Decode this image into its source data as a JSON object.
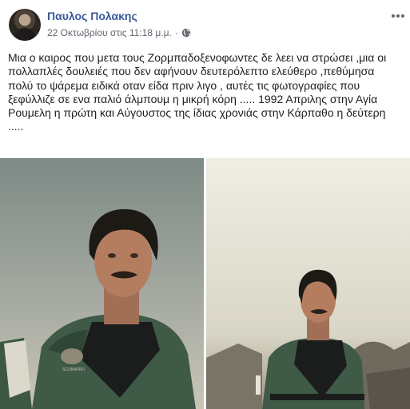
{
  "post": {
    "author": "Παυλος Πολακης",
    "timestamp": "22 Οκτωβρίου στις 11:18 μ.μ.",
    "separator": "·",
    "privacy_icon": "globe-icon",
    "more_icon": "more-options-icon",
    "text_lines": [
      "Μια ο καιρος που μετα τους Ζορμπαδοξενοφωντες δε λεει να στρώσει ,μια οι",
      "πολλαπλές δουλειές που δεν αφήνουν δευτερόλεπτο ελεύθερο ,πεθύμησα",
      "πολύ το ψάρεμα ειδικά οταν είδα πριν λιγο , αυτές τις φωτογραφίες που",
      "ξεφύλλιζε σε ενα παλιό άλμπουμ η μικρή κόρη ..... 1992 Απριλης στην Αγία",
      "Ρουμελη η πρώτη και Αύγουστος της ίδιας χρονιάς στην Κάρπαθο η δεύτερη",
      "....."
    ]
  },
  "photos": [
    {
      "name": "photo-1",
      "wetsuit_text": "SCUBAPRO"
    },
    {
      "name": "photo-2"
    }
  ],
  "colors": {
    "author_link": "#385898",
    "meta_text": "#606770",
    "body_text": "#1c1e21",
    "wetsuit_green": "#3f5a46",
    "wetsuit_black": "#1b1d1c"
  }
}
